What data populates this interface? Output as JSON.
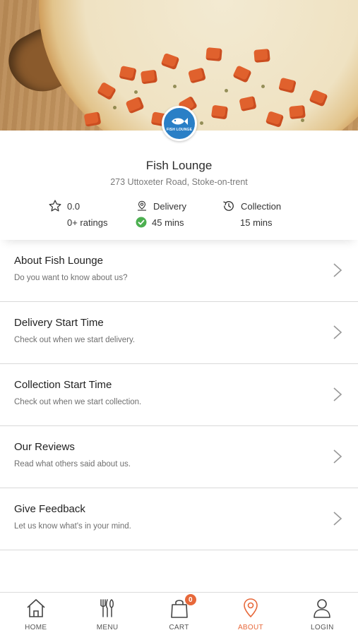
{
  "restaurant": {
    "name": "Fish Lounge",
    "address": "273 Uttoxeter Road, Stoke-on-trent",
    "logo_text": "FISH LOUNGE"
  },
  "stats": {
    "rating": {
      "value": "0.0",
      "count": "0+ ratings",
      "icon": "star-icon"
    },
    "delivery": {
      "label": "Delivery",
      "time": "45 mins",
      "icon": "location-pin-icon",
      "status_icon": "check-circle-icon",
      "status_color": "#4caf50"
    },
    "collection": {
      "label": "Collection",
      "time": "15 mins",
      "icon": "history-clock-icon"
    }
  },
  "menu_items": [
    {
      "title": "About Fish Lounge",
      "subtitle": "Do you want to know about us?"
    },
    {
      "title": "Delivery Start Time",
      "subtitle": "Check out when we start delivery."
    },
    {
      "title": "Collection Start Time",
      "subtitle": "Check out when we start collection."
    },
    {
      "title": "Our Reviews",
      "subtitle": "Read what others said about us."
    },
    {
      "title": "Give Feedback",
      "subtitle": "Let us know what's in your mind."
    }
  ],
  "tabs": [
    {
      "label": "HOME",
      "icon": "home-icon"
    },
    {
      "label": "MENU",
      "icon": "cutlery-icon"
    },
    {
      "label": "CART",
      "icon": "shopping-bag-icon",
      "badge": "0"
    },
    {
      "label": "ABOUT",
      "icon": "map-pin-icon",
      "active": true
    },
    {
      "label": "LOGIN",
      "icon": "user-icon"
    }
  ],
  "colors": {
    "accent": "#e7683a",
    "success": "#4caf50",
    "logo_blue": "#2a7fc6"
  }
}
